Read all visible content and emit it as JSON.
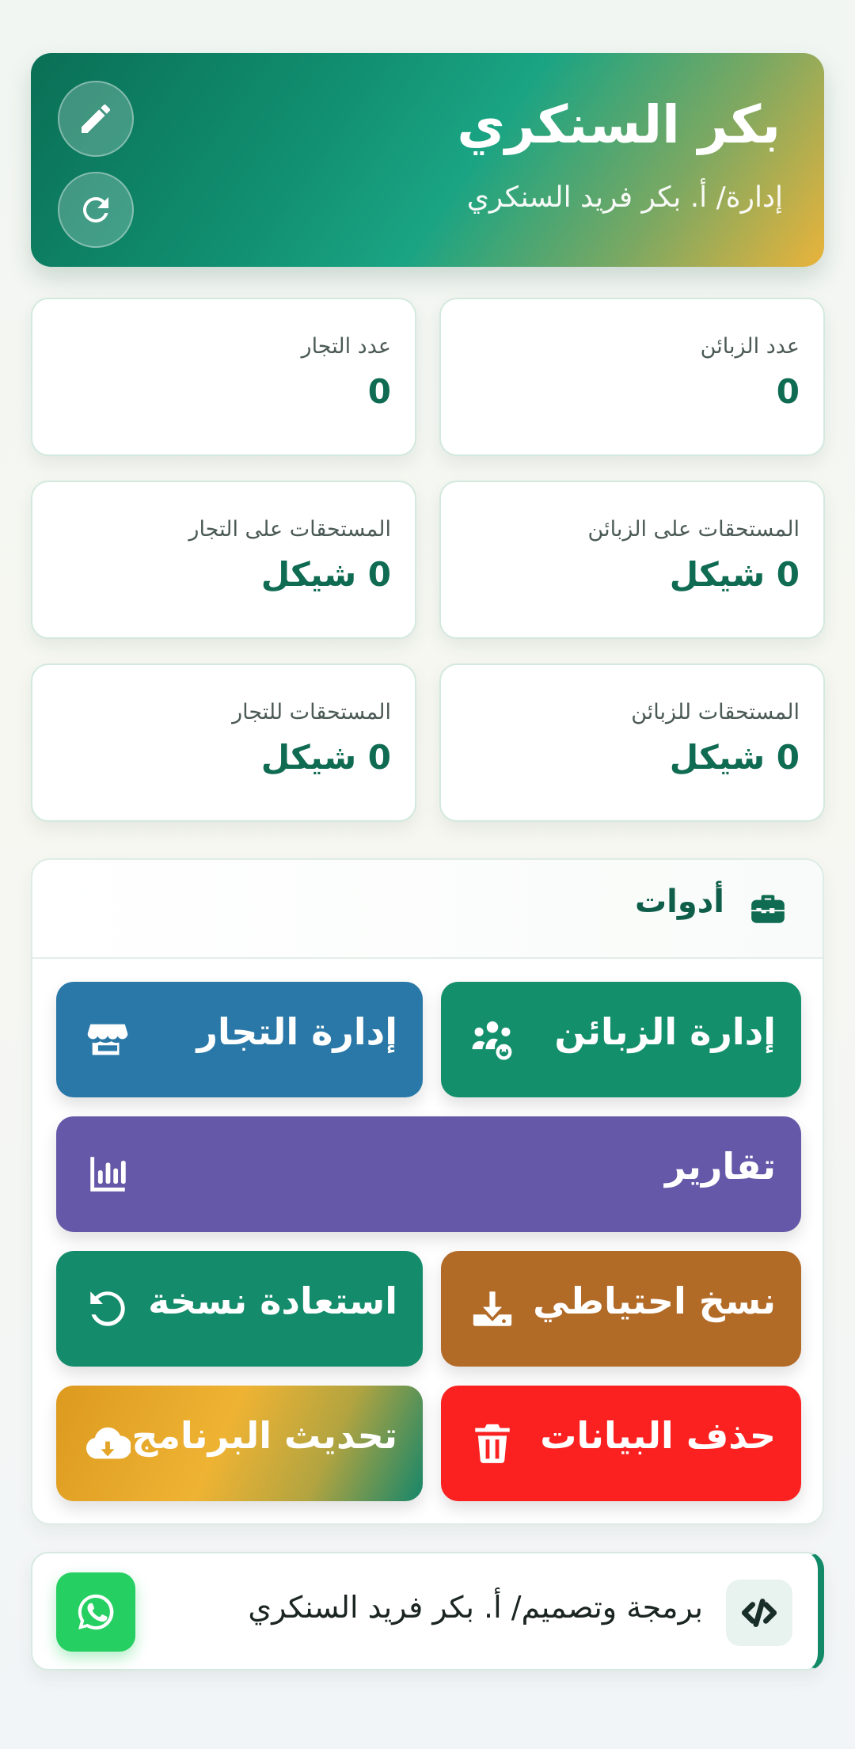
{
  "header": {
    "title": "بكر السنكري",
    "subtitle": "إدارة/ أ. بكر فريد السنكري"
  },
  "stats": {
    "customers_count": {
      "label": "عدد الزبائن",
      "value": "0"
    },
    "merchants_count": {
      "label": "عدد التجار",
      "value": "0"
    },
    "due_on_customers": {
      "label": "المستحقات على الزبائن",
      "value": "0 شيكل"
    },
    "due_on_merchants": {
      "label": "المستحقات على التجار",
      "value": "0 شيكل"
    },
    "due_to_customers": {
      "label": "المستحقات للزبائن",
      "value": "0 شيكل"
    },
    "due_to_merchants": {
      "label": "المستحقات للتجار",
      "value": "0 شيكل"
    }
  },
  "tools": {
    "title": "أدوات",
    "buttons": {
      "customers": {
        "label": "إدارة الزبائن",
        "color": "#148f6b",
        "icon": "users-gear-icon"
      },
      "merchants": {
        "label": "إدارة التجار",
        "color": "#2a78a8",
        "icon": "store-icon"
      },
      "reports": {
        "label": "تقارير",
        "color": "#6558a8",
        "icon": "chart-icon"
      },
      "backup": {
        "label": "نسخ احتياطي",
        "color": "#b26a27",
        "icon": "download-icon"
      },
      "restore": {
        "label": "استعادة نسخة",
        "color": "#148c6b",
        "icon": "restore-icon"
      },
      "delete": {
        "label": "حذف البيانات",
        "color": "#fb2121",
        "icon": "trash-icon"
      },
      "update": {
        "label": "تحديث البرنامج",
        "color": "#efb333",
        "icon": "cloud-download-icon"
      }
    }
  },
  "footer": {
    "credit": "برمجة وتصميم/ أ. بكر فريد السنكري"
  }
}
